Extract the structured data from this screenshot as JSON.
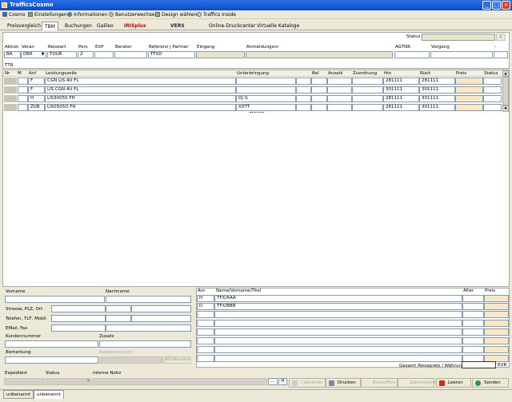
{
  "window": {
    "title": "TrafficsCosmo"
  },
  "menu": [
    {
      "label": "Cosmo"
    },
    {
      "label": "Einstellungen"
    },
    {
      "label": "Informationen"
    },
    {
      "label": "Benutzerwechsel"
    },
    {
      "label": "Design wählen"
    },
    {
      "label": "Traffics Inside"
    }
  ],
  "tabs": [
    {
      "label": "Preisvergleich"
    },
    {
      "label": "TBM"
    },
    {
      "label": "Buchungen"
    },
    {
      "label": "Galileo"
    },
    {
      "label": "IRISplus"
    },
    {
      "label": "VERS"
    },
    {
      "label": "Online-Druckcenter"
    },
    {
      "label": "Virtuelle Kataloge"
    }
  ],
  "status": {
    "label": "Status",
    "value": ""
  },
  "header_fields": {
    "aktion": {
      "label": "Aktion",
      "value": "BA"
    },
    "veran": {
      "label": "Veran",
      "value": "DER"
    },
    "reiseart": {
      "label": "Reiseart",
      "value": "TOUR"
    },
    "pers": {
      "label": "Pers",
      "value": "2"
    },
    "exp": {
      "label": "EXP",
      "value": ""
    },
    "berater": {
      "label": "Berater",
      "value": ""
    },
    "referenz": {
      "label": "Referenz | Partner",
      "value": "TFXD"
    },
    "eingang": {
      "label": "Eingang",
      "value": ""
    },
    "anmeldungsnr": {
      "label": "Anmeldungsnr",
      "value": ""
    },
    "agtnr": {
      "label": "AGTNR",
      "value": ""
    },
    "vorgang": {
      "label": "Vorgang",
      "value": ""
    },
    "dash": {
      "label": "-",
      "value": ""
    }
  },
  "ttr_label": "TTR",
  "services_table": {
    "headers": [
      "Nr",
      "M",
      "Anf",
      "Leistungszeile",
      "Unterbringung",
      "Bel",
      "Anzahl",
      "Zuordnung",
      "Hin",
      "Rück",
      "Preis",
      "Status"
    ],
    "rows": [
      {
        "anf": "F",
        "leistung": "CGN LIS 4U FL",
        "unterbringung": "",
        "hin": "281111",
        "rueck": "281111"
      },
      {
        "anf": "F",
        "leistung": "LIS CGN 4U FL",
        "unterbringung": "",
        "hin": "301111",
        "rueck": "301111"
      },
      {
        "anf": "H",
        "leistung": "LIS3005S FH",
        "unterbringung": "DJ G",
        "hin": "281111",
        "rueck": "301111"
      },
      {
        "anf": "ZUB",
        "leistung": "LIS0505O FH",
        "unterbringung": "XXTT",
        "hin": "281111",
        "rueck": "301111"
      }
    ]
  },
  "customer": {
    "vorname": "Vorname",
    "nachname": "Nachname",
    "strasse": "Strasse, PLZ, Ort",
    "telefon": "Telefon, TLF, Mobil",
    "email": "EMail, Fax",
    "kundennummer": "Kundennummer",
    "zusatz": "Zusatz",
    "kundenwunsch": "Kundenwunsch",
    "bemerkung": "Bemerkung",
    "kd_wunsch_button": "KD-Wunsch"
  },
  "travellers": {
    "headers": [
      "Anr",
      "Name/Vorname/Titel",
      "Alter",
      "Preis"
    ],
    "rows": [
      {
        "anr": "H",
        "name": "TFX/AAA"
      },
      {
        "anr": "D",
        "name": "TFX/BBB"
      }
    ],
    "total_label": "Gesamt Reisepreis / Währung",
    "currency": "EUR"
  },
  "footer": {
    "expedient": "Expedient",
    "status": "Status",
    "interne_notiz": "interne Notiz",
    "more_button": "...",
    "h_button": "H",
    "buttons": [
      {
        "label": "Callcenter",
        "enabled": false
      },
      {
        "label": "Drucken",
        "enabled": true
      },
      {
        "label": "Backoffice",
        "enabled": false
      },
      {
        "label": "Zahlungsinfo",
        "enabled": false
      },
      {
        "label": "Leeren",
        "enabled": true
      },
      {
        "label": "Senden",
        "enabled": true
      }
    ]
  },
  "session_tabs": [
    {
      "label": "unbenannt"
    },
    {
      "label": "unbenannt"
    }
  ],
  "colors": {
    "title_blue": "#0a4cc8",
    "peach": "#fde7c2",
    "tan": "#eae3c8"
  }
}
